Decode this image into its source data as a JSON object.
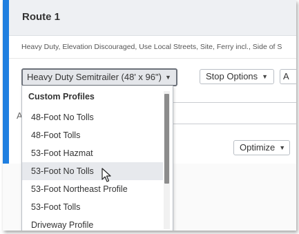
{
  "route": {
    "title": "Route 1",
    "summary": "Heavy Duty, Elevation Discouraged, Use Local Streets, Site, Ferry incl., Side of S"
  },
  "toolbar": {
    "profile_selected": "Heavy Duty Semitrailer (48' x 96\")",
    "stop_options_label": "Stop Options",
    "cut_button_label": "A",
    "optimize_label": "Optimize"
  },
  "stop_row": {
    "label_partial": "A"
  },
  "dropdown": {
    "header": "Custom Profiles",
    "options": [
      "48-Foot No Tolls",
      "48-Foot Tolls",
      "53-Foot Hazmat",
      "53-Foot No Tolls",
      "53-Foot Northeast Profile",
      "53-Foot Tolls",
      "Driveway Profile"
    ],
    "hovered_index": 3
  },
  "colors": {
    "accent": "#1f7fe0",
    "header_bg": "#eef0f3",
    "hover_bg": "#e7e9ed"
  },
  "icons": [
    "caret-down-icon",
    "mouse-pointer-icon"
  ]
}
